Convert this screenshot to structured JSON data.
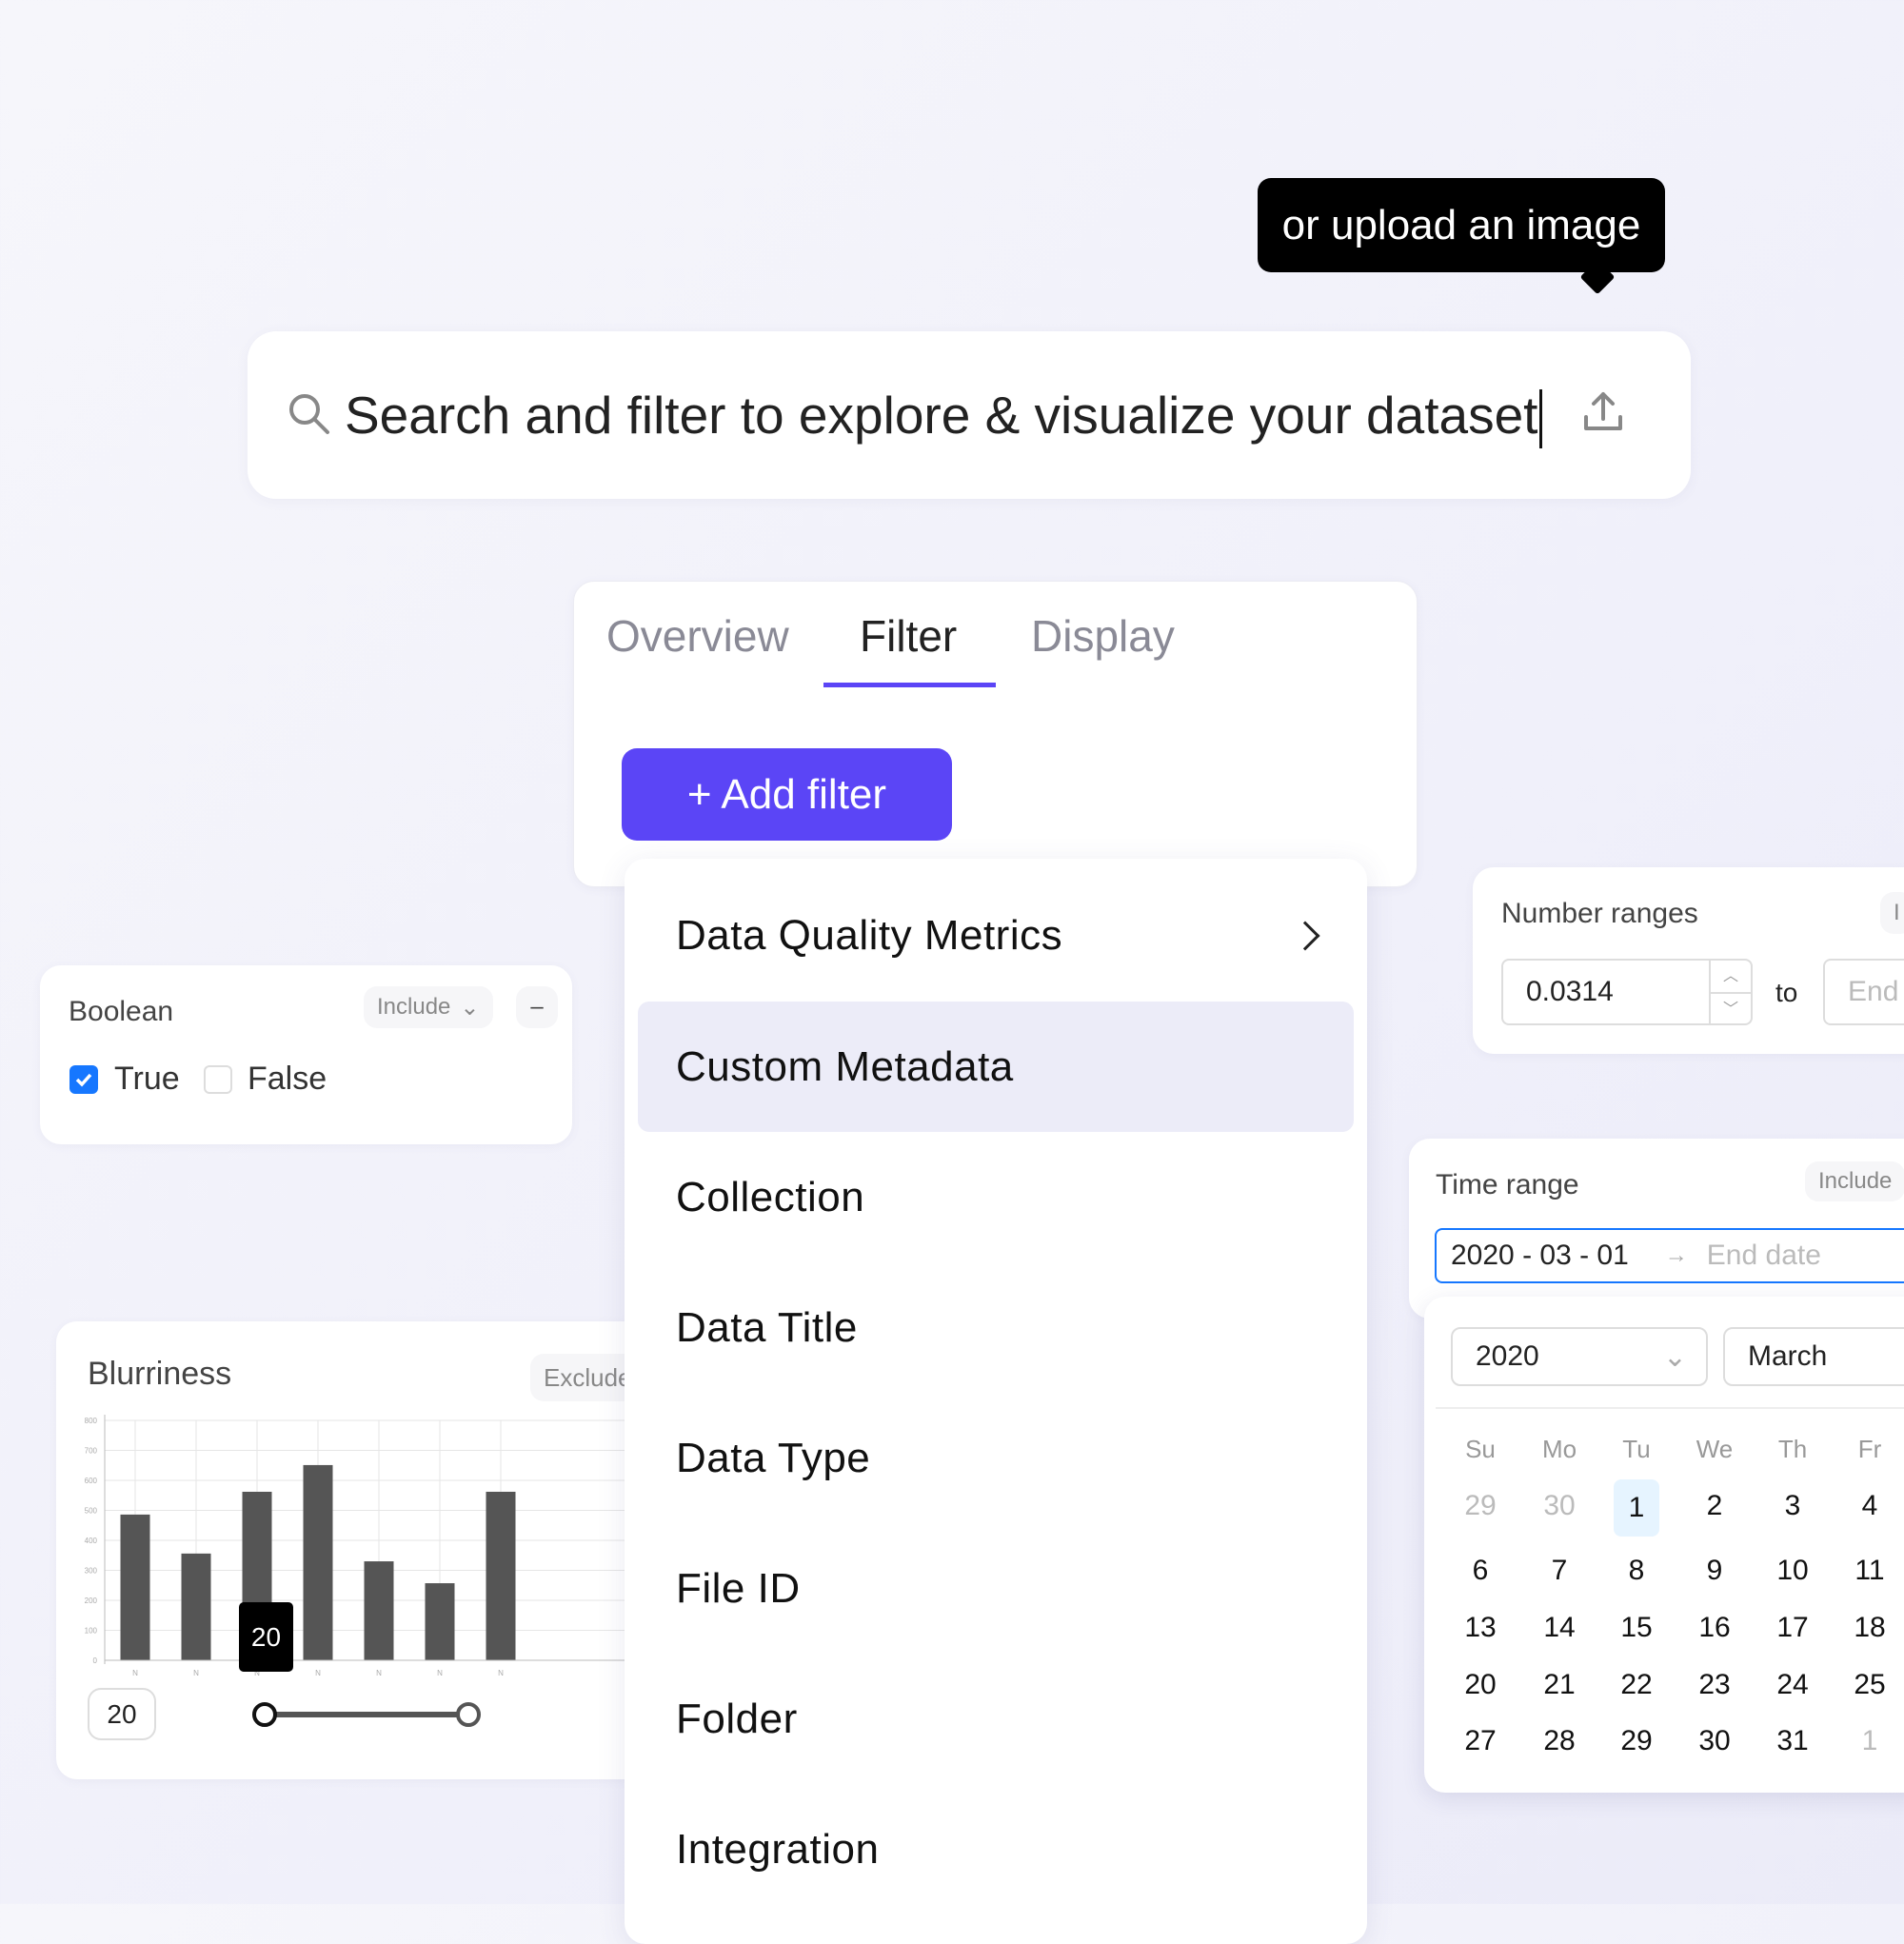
{
  "tooltip": {
    "text": "or upload an image"
  },
  "search": {
    "value": "Search and filter to explore & visualize your dataset",
    "icon": "search-icon",
    "upload_icon": "upload-icon"
  },
  "tabs": [
    {
      "label": "Overview"
    },
    {
      "label": "Filter",
      "active": true
    },
    {
      "label": "Display"
    }
  ],
  "add_filter": {
    "label": "+ Add filter",
    "color": "#5b45f6"
  },
  "filter_menu": {
    "items": [
      {
        "label": "Data Quality Metrics",
        "submenu": true
      },
      {
        "label": "Custom Metadata",
        "highlighted": true
      },
      {
        "label": "Collection"
      },
      {
        "label": "Data Title"
      },
      {
        "label": "Data Type"
      },
      {
        "label": "File ID"
      },
      {
        "label": "Folder"
      },
      {
        "label": "Integration"
      }
    ]
  },
  "boolean_card": {
    "title": "Boolean",
    "mode": "Include",
    "remove": "–",
    "options": [
      {
        "label": "True",
        "checked": true
      },
      {
        "label": "False",
        "checked": false
      }
    ],
    "check_color": "#1677ff"
  },
  "number_card": {
    "title": "Number ranges",
    "mode_partial": "I",
    "start": "0.0314",
    "to": "to",
    "end_placeholder": "End"
  },
  "time_card": {
    "title": "Time range",
    "mode": "Include",
    "start": "2020 - 03 - 01",
    "arrow": "→",
    "end_placeholder": "End date"
  },
  "calendar": {
    "year": "2020",
    "month": "March",
    "weekdays": [
      "Su",
      "Mo",
      "Tu",
      "We",
      "Th",
      "Fr"
    ],
    "weeks": [
      [
        "29",
        "30",
        "1",
        "2",
        "3",
        "4"
      ],
      [
        "6",
        "7",
        "8",
        "9",
        "10",
        "11"
      ],
      [
        "13",
        "14",
        "15",
        "16",
        "17",
        "18"
      ],
      [
        "20",
        "21",
        "22",
        "23",
        "24",
        "25"
      ],
      [
        "27",
        "28",
        "29",
        "30",
        "31",
        "1"
      ]
    ],
    "selected": "1"
  },
  "blurriness_card": {
    "title": "Blurriness",
    "mode": "Exclude",
    "min_value": "20",
    "tooltip": "20",
    "slider_range": [
      20,
      null
    ]
  },
  "chart_data": {
    "type": "bar",
    "categories": [
      "N",
      "N",
      "N",
      "N",
      "N",
      "N",
      "N"
    ],
    "values": [
      486,
      356,
      562,
      651,
      330,
      257,
      562
    ],
    "yticks": [
      "0",
      "100",
      "200",
      "300",
      "400",
      "500",
      "600",
      "700",
      "800"
    ],
    "ylim": [
      0,
      800
    ],
    "grid": true,
    "bar_color": "#555555"
  }
}
